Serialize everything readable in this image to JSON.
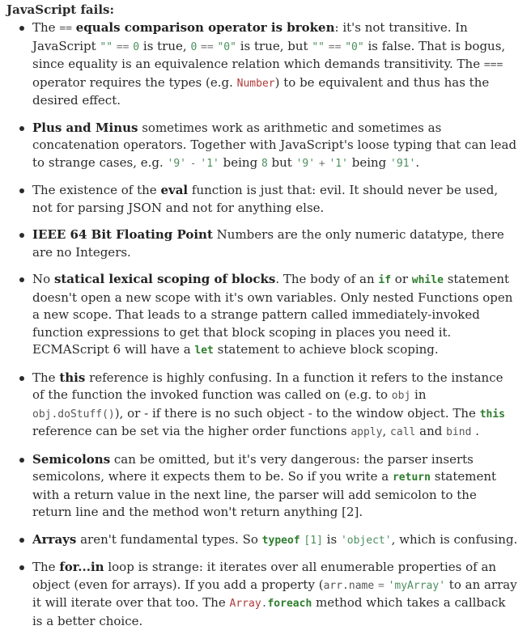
{
  "heading": "JavaScript fails:",
  "items": [
    {
      "parts": [
        {
          "t": "The ",
          "k": "text"
        },
        {
          "t": "==",
          "k": "c"
        },
        {
          "t": " ",
          "k": "text"
        },
        {
          "t": "equals comparison operator is broken",
          "k": "b"
        },
        {
          "t": ": it's not transitive. In JavaScript ",
          "k": "text"
        },
        {
          "t": "\"\"",
          "k": "s"
        },
        {
          "t": " ",
          "k": "text"
        },
        {
          "t": "==",
          "k": "o"
        },
        {
          "t": " ",
          "k": "text"
        },
        {
          "t": "0",
          "k": "n"
        },
        {
          "t": " is true, ",
          "k": "text"
        },
        {
          "t": "0",
          "k": "n"
        },
        {
          "t": " ",
          "k": "text"
        },
        {
          "t": "==",
          "k": "o"
        },
        {
          "t": " ",
          "k": "text"
        },
        {
          "t": "\"0\"",
          "k": "s"
        },
        {
          "t": " is true, but ",
          "k": "text"
        },
        {
          "t": "\"\"",
          "k": "s"
        },
        {
          "t": " ",
          "k": "text"
        },
        {
          "t": "==",
          "k": "o"
        },
        {
          "t": " ",
          "k": "text"
        },
        {
          "t": "\"0\"",
          "k": "s"
        },
        {
          "t": " is false. That is bogus, since equality is an equivalence relation which demands transitivity. The ",
          "k": "text"
        },
        {
          "t": "===",
          "k": "c"
        },
        {
          "t": " operator requires the types (e.g. ",
          "k": "text"
        },
        {
          "t": "Number",
          "k": "t"
        },
        {
          "t": ") to be equivalent and thus has the desired effect.",
          "k": "text"
        }
      ]
    },
    {
      "parts": [
        {
          "t": "Plus and Minus",
          "k": "b"
        },
        {
          "t": " sometimes work as arithmetic and sometimes as concatenation operators. Together with JavaScript's loose typing that can lead to strange cases, e.g. ",
          "k": "text"
        },
        {
          "t": "'9'",
          "k": "s"
        },
        {
          "t": " ",
          "k": "text"
        },
        {
          "t": "-",
          "k": "o"
        },
        {
          "t": " ",
          "k": "text"
        },
        {
          "t": "'1'",
          "k": "s"
        },
        {
          "t": " being ",
          "k": "text"
        },
        {
          "t": "8",
          "k": "n"
        },
        {
          "t": " but ",
          "k": "text"
        },
        {
          "t": "'9'",
          "k": "s"
        },
        {
          "t": " ",
          "k": "text"
        },
        {
          "t": "+",
          "k": "o"
        },
        {
          "t": " ",
          "k": "text"
        },
        {
          "t": "'1'",
          "k": "s"
        },
        {
          "t": " being ",
          "k": "text"
        },
        {
          "t": "'91'",
          "k": "s"
        },
        {
          "t": ".",
          "k": "text"
        }
      ]
    },
    {
      "parts": [
        {
          "t": "The existence of the ",
          "k": "text"
        },
        {
          "t": "eval",
          "k": "b"
        },
        {
          "t": " function is just that: evil. It should never be used, not for parsing JSON and not for anything else.",
          "k": "text"
        }
      ]
    },
    {
      "parts": [
        {
          "t": "IEEE 64 Bit Floating Point",
          "k": "b"
        },
        {
          "t": " Numbers are the only numeric datatype, there are no Integers.",
          "k": "text"
        }
      ]
    },
    {
      "parts": [
        {
          "t": "No ",
          "k": "text"
        },
        {
          "t": "statical lexical scoping of blocks",
          "k": "b"
        },
        {
          "t": ". The body of an ",
          "k": "text"
        },
        {
          "t": "if",
          "k": "k"
        },
        {
          "t": " or ",
          "k": "text"
        },
        {
          "t": "while",
          "k": "k"
        },
        {
          "t": " statement doesn't open a new scope with it's own variables. Only nested Functions open a new scope. That leads to a strange pattern called immediately-invoked function expressions to get that block scoping in places you need it. ECMAScript 6 will have a ",
          "k": "text"
        },
        {
          "t": "let",
          "k": "k"
        },
        {
          "t": " statement to achieve block scoping.",
          "k": "text"
        }
      ]
    },
    {
      "parts": [
        {
          "t": "The ",
          "k": "text"
        },
        {
          "t": "this",
          "k": "b"
        },
        {
          "t": " reference is highly confusing. In a function it refers to the instance of the function the invoked function was called on (e.g. to ",
          "k": "text"
        },
        {
          "t": "obj",
          "k": "c"
        },
        {
          "t": " in ",
          "k": "text"
        },
        {
          "t": "obj.doStuff()",
          "k": "c"
        },
        {
          "t": "), or - if there is no such object - to the window object. The ",
          "k": "text"
        },
        {
          "t": "this",
          "k": "k"
        },
        {
          "t": " reference can be set via the higher order functions ",
          "k": "text"
        },
        {
          "t": "apply",
          "k": "c"
        },
        {
          "t": ", ",
          "k": "text"
        },
        {
          "t": "call",
          "k": "c"
        },
        {
          "t": " and ",
          "k": "text"
        },
        {
          "t": "bind",
          "k": "c"
        },
        {
          "t": " .",
          "k": "text"
        }
      ]
    },
    {
      "parts": [
        {
          "t": "Semicolons",
          "k": "b"
        },
        {
          "t": " can be omitted, but it's very dangerous: the parser inserts semicolons, where it expects them to be. So if you write a ",
          "k": "text"
        },
        {
          "t": "return",
          "k": "k"
        },
        {
          "t": "  statement with a return value in the next line, the parser will add semicolon to the return line and the method won't return anything [2].",
          "k": "text"
        }
      ]
    },
    {
      "parts": [
        {
          "t": "Arrays",
          "k": "b"
        },
        {
          "t": " aren't fundamental types. So ",
          "k": "text"
        },
        {
          "t": "typeof",
          "k": "k"
        },
        {
          "t": " ",
          "k": "text"
        },
        {
          "t": "[1]",
          "k": "n"
        },
        {
          "t": " is ",
          "k": "text"
        },
        {
          "t": "'object'",
          "k": "s"
        },
        {
          "t": ", which is confusing.",
          "k": "text"
        }
      ]
    },
    {
      "parts": [
        {
          "t": "The ",
          "k": "text"
        },
        {
          "t": "for...in",
          "k": "b"
        },
        {
          "t": " loop is strange: it iterates over all enumerable properties of an object (even for arrays). If you add a property (",
          "k": "text"
        },
        {
          "t": "arr.name",
          "k": "c"
        },
        {
          "t": " ",
          "k": "text"
        },
        {
          "t": "=",
          "k": "o"
        },
        {
          "t": " ",
          "k": "text"
        },
        {
          "t": "'myArray'",
          "k": "s"
        },
        {
          "t": " to an array it will iterate over that too. The ",
          "k": "text"
        },
        {
          "t": "Array",
          "k": "t"
        },
        {
          "t": ".",
          "k": "c"
        },
        {
          "t": "foreach",
          "k": "k"
        },
        {
          "t": " method which takes a callback is a better choice.",
          "k": "text"
        }
      ]
    }
  ]
}
